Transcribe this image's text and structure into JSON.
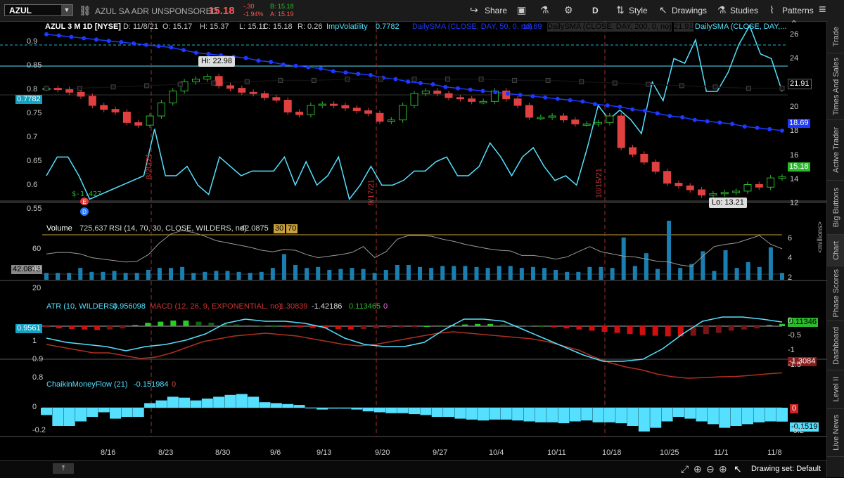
{
  "toolbar": {
    "symbol": "AZUL",
    "description": "AZUL SA ADR UNSPONSORED",
    "last": "15.18",
    "net_change": "-.30",
    "pct_change": "-1.94%",
    "bid": "B: 15.18",
    "ask": "A: 15.19",
    "share_label": "Share",
    "style_label": "Style",
    "drawings_label": "Drawings",
    "studies_label": "Studies",
    "patterns_label": "Patterns",
    "aggregation": "D"
  },
  "header": {
    "title": "AZUL 3 M 1D [NYSE]",
    "date": "D: 11/8/21",
    "open": "O: 15.17",
    "high": "H: 15.37",
    "low": "L: 15.11",
    "close": "C: 15.18",
    "range": "R: 0.26",
    "impvol_label": "ImpVolatility",
    "impvol_value": "0.7782",
    "sma1": "DailySMA (CLOSE, DAY, 50, 0, no)",
    "sma1_value": "18.69",
    "sma2": "DailySMA (CLOSE, DAY, 200, 0, no)",
    "sma2_value": "21.91",
    "sma3": "DailySMA (CLOSE, DAY,..."
  },
  "price_pane": {
    "left_ticks": [
      "0.9",
      "0.85",
      "0.8",
      "0.75",
      "0.7",
      "0.65",
      "0.6",
      "0.55"
    ],
    "right_ticks": [
      "26",
      "24",
      "22",
      "20",
      "18",
      "16",
      "14",
      "12"
    ],
    "impvol_tag": "0.7782",
    "sma200_tag": "21.91",
    "sma50_tag": "18.69",
    "price_tag": "15.18",
    "hi_label": "Hi: 22.98",
    "lo_label": "Lo: 13.21",
    "dividend_label": "$-1.427",
    "marker_dates": [
      "8/20/21",
      "9/17/21",
      "10/15/21"
    ]
  },
  "volume_pane": {
    "label": "Volume",
    "volume": "725,637",
    "rsi": "RSI (14, 70, 30, CLOSE, WILDERS, no)",
    "rsi_value": "42.0875",
    "ob": "30",
    "os": "70",
    "left_ticks": [
      "60",
      "40",
      "20"
    ],
    "right_ticks": [
      "6",
      "4",
      "2"
    ],
    "unit": "<millions>",
    "rsi_tag": "42.0875"
  },
  "atr_pane": {
    "atr": "ATR (10, WILDERS)",
    "atr_value": "0.956098",
    "macd": "MACD (12, 26, 9, EXPONENTIAL, no)",
    "macd_value": "-1.30839",
    "macd_avg": "-1.42186",
    "macd_diff": "0.113465",
    "zero": "0",
    "left_ticks": [
      "1",
      "0.9",
      "0.8"
    ],
    "right_ticks": [
      "0",
      "-0.5",
      "-1",
      "-1.5"
    ],
    "atr_tag": "0.9561",
    "diff_tag": "0.11346",
    "macd_tag": "-1.3084"
  },
  "cmf_pane": {
    "label": "ChaikinMoneyFlow (21)",
    "value": "-0.151984",
    "zero": "0",
    "left_ticks": [
      "0",
      "-0.2"
    ],
    "right_ticks": [
      "-0.2"
    ],
    "zero_tag": "0",
    "value_tag": "-0.1519"
  },
  "x_axis": [
    "8/16",
    "8/23",
    "8/30",
    "9/6",
    "9/13",
    "9/20",
    "9/27",
    "10/4",
    "10/11",
    "10/18",
    "10/25",
    "11/1",
    "11/8"
  ],
  "sidebar": [
    "Trade",
    "Times And Sales",
    "Active Trader",
    "Big Buttons",
    "Chart",
    "Phase Scores",
    "Dashboard",
    "Level II",
    "Live News"
  ],
  "footer": {
    "drawing_set": "Drawing set: Default"
  },
  "colors": {
    "up": "#2db82d",
    "down": "#e04040",
    "impvol": "#55e0ff",
    "sma50": "#1d39ff",
    "sma200": "#111111",
    "accent": "#00d8ff"
  },
  "chart_data": {
    "type": "candlestick",
    "dates": [
      "8/9",
      "8/10",
      "8/11",
      "8/12",
      "8/13",
      "8/16",
      "8/17",
      "8/18",
      "8/19",
      "8/20",
      "8/23",
      "8/24",
      "8/25",
      "8/26",
      "8/27",
      "8/30",
      "8/31",
      "9/1",
      "9/2",
      "9/3",
      "9/7",
      "9/8",
      "9/9",
      "9/10",
      "9/13",
      "9/14",
      "9/15",
      "9/16",
      "9/17",
      "9/20",
      "9/21",
      "9/22",
      "9/23",
      "9/24",
      "9/27",
      "9/28",
      "9/29",
      "9/30",
      "10/1",
      "10/4",
      "10/5",
      "10/6",
      "10/7",
      "10/8",
      "10/11",
      "10/12",
      "10/13",
      "10/14",
      "10/15",
      "10/18",
      "10/19",
      "10/20",
      "10/21",
      "10/22",
      "10/25",
      "10/26",
      "10/27",
      "10/28",
      "10/29",
      "11/1",
      "11/2",
      "11/3",
      "11/4",
      "11/5",
      "11/8"
    ],
    "close": [
      21.9,
      21.8,
      21.6,
      21.3,
      20.6,
      20.3,
      20.1,
      19.3,
      19.1,
      19.8,
      20.8,
      21.7,
      22.4,
      22.6,
      22.8,
      22.1,
      21.9,
      21.6,
      21.5,
      21.2,
      21.0,
      20.1,
      19.9,
      20.6,
      20.7,
      20.6,
      20.4,
      20.2,
      20.0,
      19.4,
      19.5,
      20.6,
      21.5,
      21.7,
      21.5,
      21.2,
      21.1,
      20.9,
      20.9,
      21.7,
      21.1,
      20.6,
      19.7,
      19.7,
      19.8,
      19.5,
      19.2,
      19.2,
      19.3,
      19.8,
      17.4,
      16.9,
      16.3,
      15.6,
      14.7,
      14.5,
      14.2,
      13.8,
      13.9,
      14.0,
      14.1,
      14.6,
      14.4,
      15.1,
      15.18
    ],
    "volume_millions": [
      0.7,
      0.7,
      0.7,
      1.2,
      0.8,
      0.8,
      0.9,
      0.7,
      0.7,
      1.0,
      1.2,
      1.2,
      1.3,
      0.7,
      0.8,
      0.9,
      0.9,
      0.8,
      0.7,
      0.8,
      1.2,
      2.6,
      1.5,
      1.2,
      1.3,
      1.0,
      1.1,
      1.2,
      1.1,
      0.7,
      1.0,
      1.5,
      1.5,
      1.3,
      1.2,
      1.4,
      1.4,
      1.4,
      1.3,
      1.2,
      1.4,
      1.4,
      1.2,
      1.3,
      1.2,
      1.0,
      0.8,
      0.8,
      1.3,
      1.3,
      1.2,
      4.3,
      1.4,
      2.7,
      1.1,
      6.0,
      1.2,
      1.6,
      2.9,
      0.9,
      3.0,
      1.2,
      1.8,
      1.3,
      3.3,
      0.7
    ],
    "impvol": [
      0.6,
      0.64,
      0.64,
      0.6,
      0.55,
      0.56,
      0.57,
      0.58,
      0.59,
      0.6,
      0.7,
      0.6,
      0.6,
      0.62,
      0.58,
      0.56,
      0.64,
      0.62,
      0.6,
      0.61,
      0.61,
      0.61,
      0.64,
      0.58,
      0.63,
      0.58,
      0.6,
      0.64,
      0.55,
      0.58,
      0.62,
      0.58,
      0.58,
      0.59,
      0.61,
      0.61,
      0.63,
      0.64,
      0.6,
      0.6,
      0.62,
      0.67,
      0.64,
      0.6,
      0.64,
      0.66,
      0.62,
      0.59,
      0.6,
      0.58,
      0.66,
      0.75,
      0.72,
      0.74,
      0.72,
      0.69,
      0.8,
      0.76,
      0.85,
      0.84,
      0.89,
      0.78,
      0.78,
      0.82,
      0.88,
      0.92,
      0.86,
      0.85,
      0.78
    ],
    "sma50": [
      26,
      25.9,
      25.8,
      25.7,
      25.6,
      25.5,
      25.4,
      25.3,
      25.2,
      25.1,
      25,
      24.8,
      24.6,
      24.5,
      24.4,
      24.3,
      24.2,
      24,
      23.9,
      23.7,
      23.6,
      23.5,
      23.4,
      23.2,
      23.1,
      23,
      22.9,
      22.7,
      22.6,
      22.4,
      22.3,
      22.2,
      22,
      21.9,
      21.8,
      21.7,
      21.6,
      21.5,
      21.4,
      21.3,
      21.2,
      21.1,
      21,
      20.9,
      20.7,
      20.6,
      20.5,
      20.3,
      20.2,
      20,
      19.8,
      19.7,
      19.5,
      19.4,
      19.3,
      19.2,
      19,
      18.9,
      18.8,
      18.69
    ],
    "sma200": [
      21.9,
      21.9,
      22.0,
      22.1,
      22.2,
      22.3,
      22.4,
      22.5,
      22.5,
      22.6,
      22.6,
      22.6,
      22.6,
      22.6,
      22.5,
      22.5,
      22.4,
      22.3,
      22.2,
      22.1,
      22.0,
      21.9,
      21.91
    ],
    "rsi": [
      35,
      37,
      37,
      35,
      30,
      28,
      26,
      24,
      25,
      34,
      50,
      62,
      67,
      64,
      59,
      53,
      50,
      47,
      44,
      40,
      38,
      41,
      40,
      34,
      30,
      32,
      34,
      37,
      45,
      30,
      38,
      55,
      60,
      60,
      59,
      55,
      52,
      48,
      45,
      42,
      40,
      39,
      33,
      33,
      31,
      28,
      31,
      38,
      45,
      38,
      35,
      32,
      31,
      28,
      25,
      24,
      20,
      18,
      32,
      45,
      48,
      50,
      55,
      60,
      48,
      42
    ],
    "macd": [
      -0.3,
      -0.4,
      -0.5,
      -0.6,
      -0.6,
      -0.7,
      -0.8,
      -0.75,
      -0.6,
      -0.4,
      -0.2,
      -0.1,
      0,
      0.05,
      0.1,
      0.05,
      0,
      -0.1,
      -0.2,
      -0.3,
      -0.35,
      -0.3,
      -0.2,
      -0.1,
      0,
      0.1,
      0.15,
      0.1,
      0.05,
      0,
      -0.05,
      -0.1,
      -0.2,
      -0.35,
      -0.5,
      -0.75,
      -0.95,
      -1.1,
      -1.2,
      -1.35,
      -1.45,
      -1.5,
      -1.48,
      -1.45,
      -1.44,
      -1.4,
      -1.35,
      -1.3084
    ],
    "atr": [
      0.88,
      0.86,
      0.85,
      0.84,
      0.82,
      0.84,
      0.85,
      0.87,
      0.9,
      0.95,
      0.97,
      0.96,
      0.96,
      0.95,
      0.93,
      0.88,
      0.85,
      0.84,
      0.84,
      0.86,
      0.92,
      0.97,
      0.97,
      0.96,
      0.92,
      0.88,
      0.84,
      0.8,
      0.77,
      0.77,
      0.78,
      0.83,
      0.9,
      0.96,
      0.98,
      0.98,
      0.97,
      0.9561
    ],
    "cmf": [
      -0.08,
      -0.2,
      -0.2,
      -0.15,
      -0.1,
      -0.05,
      -0.12,
      -0.1,
      -0.1,
      0.05,
      0.08,
      0.12,
      0.11,
      0.08,
      0.1,
      0.12,
      0.14,
      0.15,
      0.12,
      0.06,
      0.05,
      0.04,
      0.03,
      0.0,
      -0.02,
      -0.01,
      -0.01,
      -0.02,
      -0.04,
      -0.05,
      -0.06,
      -0.06,
      -0.07,
      -0.08,
      -0.1,
      -0.1,
      -0.12,
      -0.13,
      -0.14,
      -0.13,
      -0.13,
      -0.14,
      -0.15,
      -0.16,
      -0.16,
      -0.17,
      -0.15,
      -0.14,
      -0.16,
      -0.16,
      -0.17,
      -0.2,
      -0.26,
      -0.22,
      -0.15,
      -0.1,
      -0.12,
      -0.15,
      -0.18,
      -0.22,
      -0.2,
      -0.18,
      -0.16,
      -0.15,
      -0.1519
    ]
  }
}
